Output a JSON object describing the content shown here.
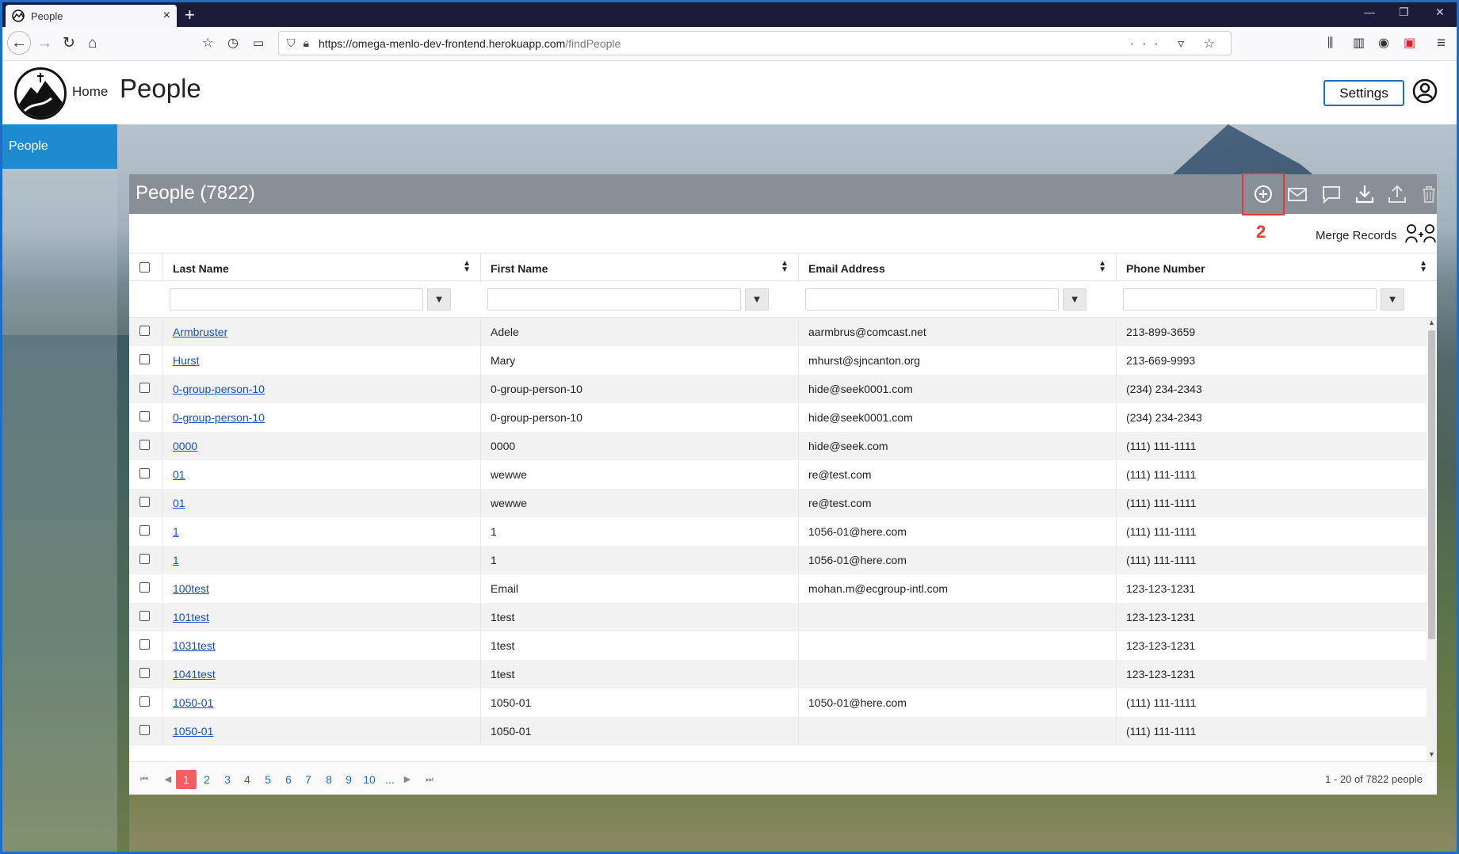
{
  "browser": {
    "tab_title": "People",
    "url_host": "https://omega-menlo-dev-frontend.herokuapp.com",
    "url_path": "/findPeople"
  },
  "header": {
    "home_label": "Home",
    "page_title": "People",
    "settings_label": "Settings"
  },
  "sidebar": {
    "items": [
      {
        "label": "People",
        "active": true
      }
    ]
  },
  "panel": {
    "title": "People (7822)",
    "annotation": "2",
    "merge_label": "Merge Records",
    "toolbar_icons": [
      "add-circle-icon",
      "email-icon",
      "message-icon",
      "download-icon",
      "upload-icon",
      "trash-icon"
    ]
  },
  "table": {
    "columns": [
      "Last Name",
      "First Name",
      "Email Address",
      "Phone Number"
    ],
    "rows": [
      [
        "Armbruster",
        "Adele",
        "aarmbrus@comcast.net",
        "213-899-3659"
      ],
      [
        "Hurst",
        "Mary",
        "mhurst@sjncanton.org",
        "213-669-9993"
      ],
      [
        "0-group-person-10",
        "0-group-person-10",
        "hide@seek0001.com",
        "(234) 234-2343"
      ],
      [
        "0-group-person-10",
        "0-group-person-10",
        "hide@seek0001.com",
        "(234) 234-2343"
      ],
      [
        "0000",
        "0000",
        "hide@seek.com",
        "(111) 111-1111"
      ],
      [
        "01",
        "wewwe",
        "re@test.com",
        "(111) 111-1111"
      ],
      [
        "01",
        "wewwe",
        "re@test.com",
        "(111) 111-1111"
      ],
      [
        "1",
        "1",
        "1056-01@here.com",
        "(111) 111-1111"
      ],
      [
        "1",
        "1",
        "1056-01@here.com",
        "(111) 111-1111"
      ],
      [
        "100test",
        "Email",
        "mohan.m@ecgroup-intl.com",
        "123-123-1231"
      ],
      [
        "101test",
        "1test",
        "",
        "123-123-1231"
      ],
      [
        "1031test",
        "1test",
        "",
        "123-123-1231"
      ],
      [
        "1041test",
        "1test",
        "",
        "123-123-1231"
      ],
      [
        "1050-01",
        "1050-01",
        "1050-01@here.com",
        "(111) 111-1111"
      ],
      [
        "1050-01",
        "1050-01",
        "",
        "(111) 111-1111"
      ]
    ]
  },
  "pager": {
    "pages": [
      "1",
      "2",
      "3",
      "4",
      "5",
      "6",
      "7",
      "8",
      "9",
      "10",
      "..."
    ],
    "current": "1",
    "info": "1 - 20 of 7822 people"
  },
  "colors": {
    "accent": "#1e8bd0",
    "annotation": "#e53935",
    "link": "#1a4fb5",
    "active_page": "#f06060"
  }
}
